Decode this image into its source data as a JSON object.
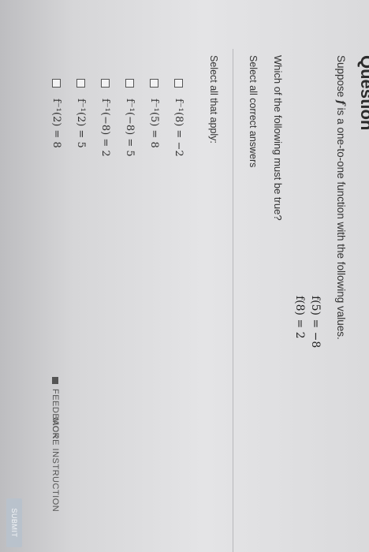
{
  "question": {
    "title": "Question",
    "intro_before": "Suppose ",
    "intro_f": "f",
    "intro_after": " is a one-to-one function with the following values.",
    "values": [
      "f(5) = −8",
      "f(8) = 2"
    ],
    "prompt": "Which of the following must be true?",
    "hint": "Select all correct answers",
    "instruction": "Select all that apply:",
    "options": [
      "f⁻¹(8) = −2",
      "f⁻¹(5) = 8",
      "f⁻¹(−8) = 5",
      "f⁻¹(−8) = 2",
      "f⁻¹(2) = 5",
      "f⁻¹(2) = 8"
    ]
  },
  "footer": {
    "feedback": "FEEDBACK",
    "more_instruction": "MORE INSTRUCTION",
    "submit": "SUBMIT"
  }
}
